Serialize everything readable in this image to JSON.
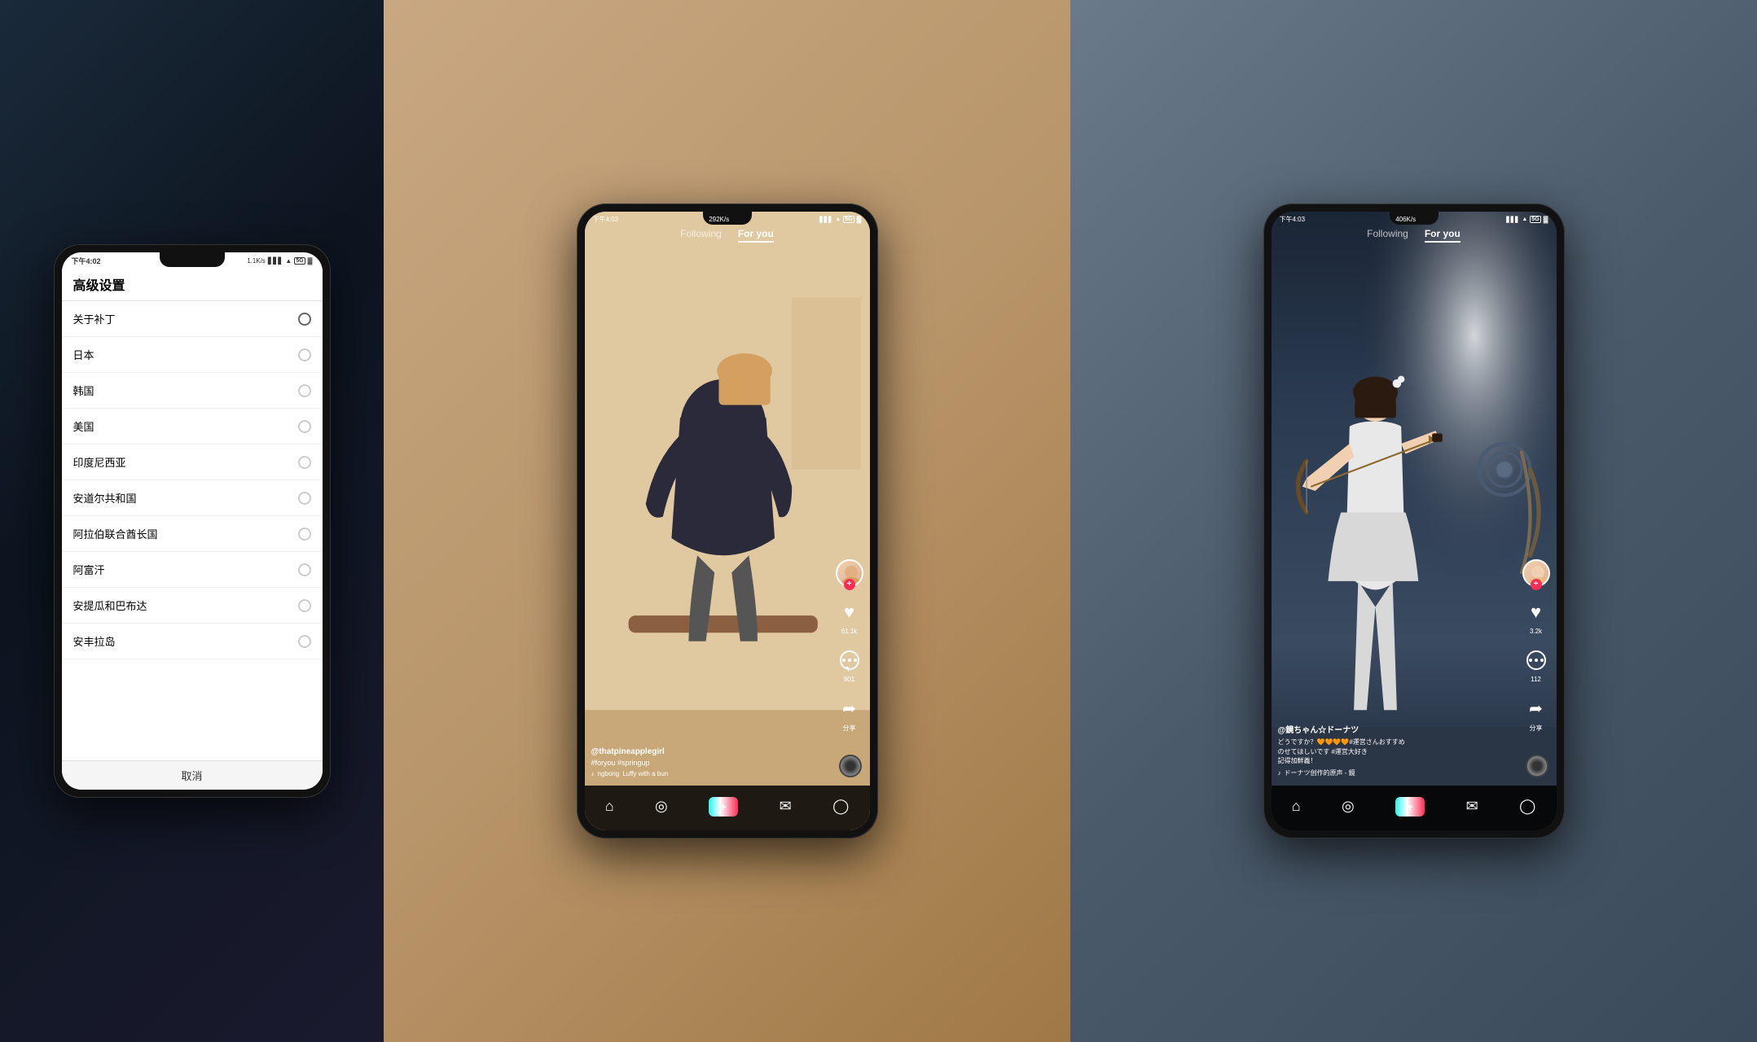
{
  "leftPhone": {
    "statusbar": {
      "time": "下午4:02",
      "speed": "1.1K/s",
      "carrier": "",
      "network": "5G"
    },
    "settingsTitle": "高级设置",
    "items": [
      {
        "label": "关于补丁",
        "selected": true
      },
      {
        "label": "日本",
        "selected": false
      },
      {
        "label": "韩国",
        "selected": false
      },
      {
        "label": "美国",
        "selected": false
      },
      {
        "label": "印度尼西亚",
        "selected": false
      },
      {
        "label": "安道尔共和国",
        "selected": false
      },
      {
        "label": "阿拉伯联合酋长国",
        "selected": false
      },
      {
        "label": "阿富汗",
        "selected": false
      },
      {
        "label": "安提瓜和巴布达",
        "selected": false
      },
      {
        "label": "安丰拉岛",
        "selected": false
      }
    ],
    "cancelButton": "取消"
  },
  "midPhone": {
    "statusbar": {
      "time": "下午4:03",
      "speed": "292K/s",
      "network": "5G"
    },
    "nav": {
      "following": "Following",
      "forYou": "For you"
    },
    "likes": "61.1k",
    "comments": "801",
    "shareLabel": "分享",
    "username": "@thatpineapplegirl",
    "tags": "#foryou #springup",
    "musicArtist": "ngbong",
    "musicTitle": "Luffy with a bun"
  },
  "rightPhone": {
    "statusbar": {
      "time": "下午4:03",
      "speed": "406K/s",
      "network": "5G"
    },
    "nav": {
      "following": "Following",
      "forYou": "For you"
    },
    "likes": "3.2k",
    "comments": "112",
    "shareLabel": "分享",
    "username": "@鏡ちゃん☆ドーナツ",
    "caption1": "どうですか？🧡🧡🧡🧡#運営さんおすすめ",
    "caption2": "のせてほしいです #運営大好き",
    "caption3": "記得加鮮義！",
    "musicTitle": "ドーナツ创作的原声 - 鏡"
  },
  "icons": {
    "home": "⌂",
    "discover": "🔍",
    "plus": "+",
    "messages": "💬",
    "profile": "👤",
    "heart": "♥",
    "comment": "💬",
    "share": "➦",
    "music": "♪"
  }
}
